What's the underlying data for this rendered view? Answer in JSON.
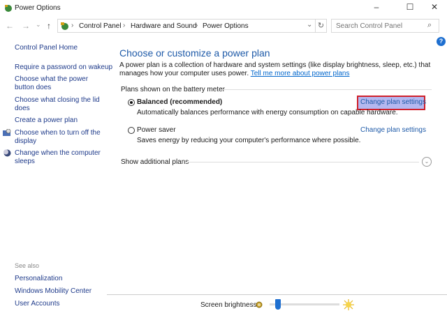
{
  "window": {
    "title": "Power Options",
    "minimize": "–",
    "maximize": "☐",
    "close": "✕"
  },
  "nav": {
    "back": "←",
    "forward": "→",
    "recent": "⌄",
    "up": "↑",
    "breadcrumb": [
      "Control Panel",
      "Hardware and Sound",
      "Power Options"
    ],
    "dropdown": "⌄",
    "refresh": "↻",
    "search_placeholder": "Search Control Panel",
    "search_icon": "⌕"
  },
  "sidebar": {
    "items": [
      "Control Panel Home",
      "Require a password on wakeup",
      "Choose what the power button does",
      "Choose what closing the lid does",
      "Create a power plan",
      "Choose when to turn off the display",
      "Change when the computer sleeps"
    ],
    "see_also": "See also",
    "see_also_items": [
      "Personalization",
      "Windows Mobility Center",
      "User Accounts"
    ]
  },
  "main": {
    "heading": "Choose or customize a power plan",
    "description": "A power plan is a collection of hardware and system settings (like display brightness, sleep, etc.) that manages how your computer uses power.",
    "learn_more": "Tell me more about power plans",
    "group_label": "Plans shown on the battery meter",
    "plans": [
      {
        "name": "Balanced (recommended)",
        "selected": true,
        "description": "Automatically balances performance with energy consumption on capable hardware.",
        "link": "Change plan settings"
      },
      {
        "name": "Power saver",
        "selected": false,
        "description": "Saves energy by reducing your computer's performance where possible.",
        "link": "Change plan settings"
      }
    ],
    "show_more": "Show additional plans",
    "help": "?",
    "chevron": "⌄"
  },
  "brightness": {
    "label": "Screen brightness:",
    "value_percent": 12
  }
}
